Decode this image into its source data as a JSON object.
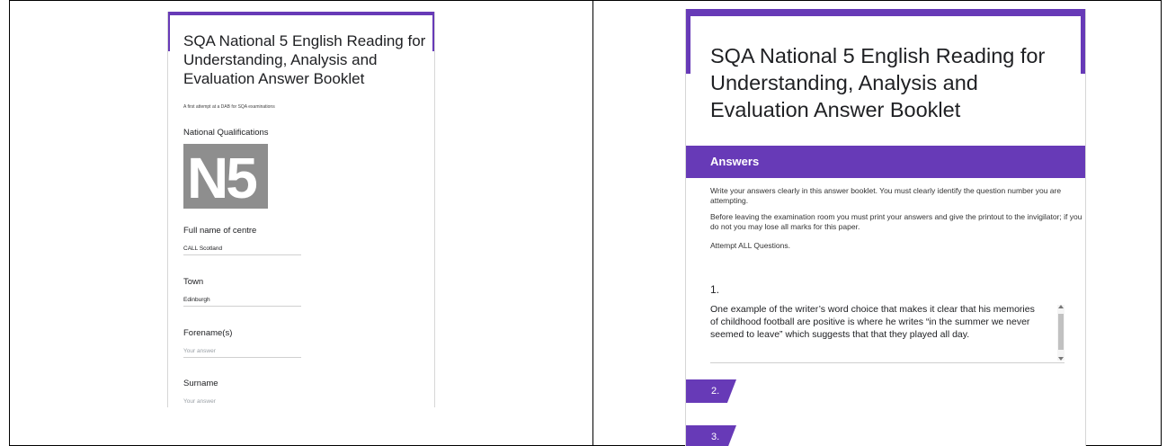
{
  "left_form": {
    "title": "SQA National 5 English Reading for Understanding, Analysis and Evaluation Answer Booklet",
    "description": "A first attempt at a DAB for SQA examinations",
    "qualifications_label": "National Qualifications",
    "logo_text": "N5",
    "fields": [
      {
        "label": "Full name of centre",
        "value": "CALL Scotland"
      },
      {
        "label": "Town",
        "value": "Edinburgh"
      },
      {
        "label": "Forename(s)",
        "placeholder": "Your answer"
      },
      {
        "label": "Surname",
        "placeholder": "Your answer"
      }
    ],
    "accent_color": "#673ab7"
  },
  "right_form": {
    "title": "SQA National 5 English Reading for Understanding, Analysis and Evaluation Answer Booklet",
    "section_title": "Answers",
    "instructions": [
      "Write your answers clearly in this answer booklet. You must clearly identify the question number you are attempting.",
      "Before leaving the examination room you must print your answers and give the printout to the invigilator; if you do not you may lose all marks for this paper.",
      "Attempt ALL Questions."
    ],
    "question_1": {
      "number": "1.",
      "answer": "One example of the writer’s word choice that makes it clear that his memories of childhood football are positive is where he writes “in the summer we never seemed to leave” which suggests that that they played all day."
    },
    "question_tabs": [
      "2.",
      "3."
    ],
    "accent_color": "#673ab7"
  }
}
